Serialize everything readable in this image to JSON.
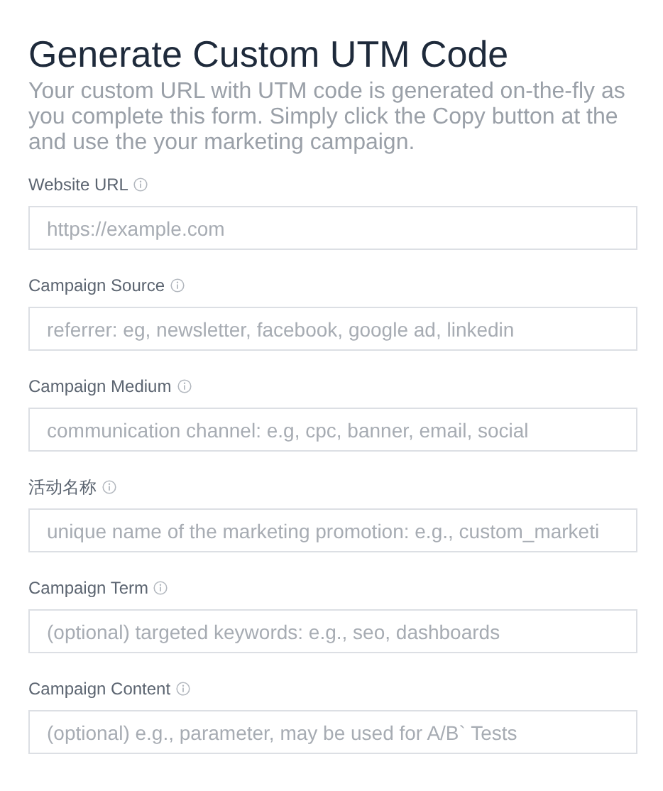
{
  "title": "Generate Custom UTM Code",
  "description": "Your custom URL with UTM code is generated on-the-fly as you complete this form. Simply click the Copy button at the and use the your marketing campaign.",
  "fields": [
    {
      "label": "Website URL",
      "placeholder": "https://example.com"
    },
    {
      "label": "Campaign Source",
      "placeholder": "referrer: eg, newsletter, facebook, google ad, linkedin"
    },
    {
      "label": "Campaign Medium",
      "placeholder": "communication channel: e.g, cpc, banner, email, social"
    },
    {
      "label": "活动名称",
      "placeholder": "unique name of the marketing promotion: e.g., custom_marketi"
    },
    {
      "label": "Campaign Term",
      "placeholder": "(optional) targeted keywords: e.g., seo, dashboards"
    },
    {
      "label": "Campaign Content",
      "placeholder": "(optional) e.g., parameter, may be used for A/B` Tests"
    }
  ]
}
